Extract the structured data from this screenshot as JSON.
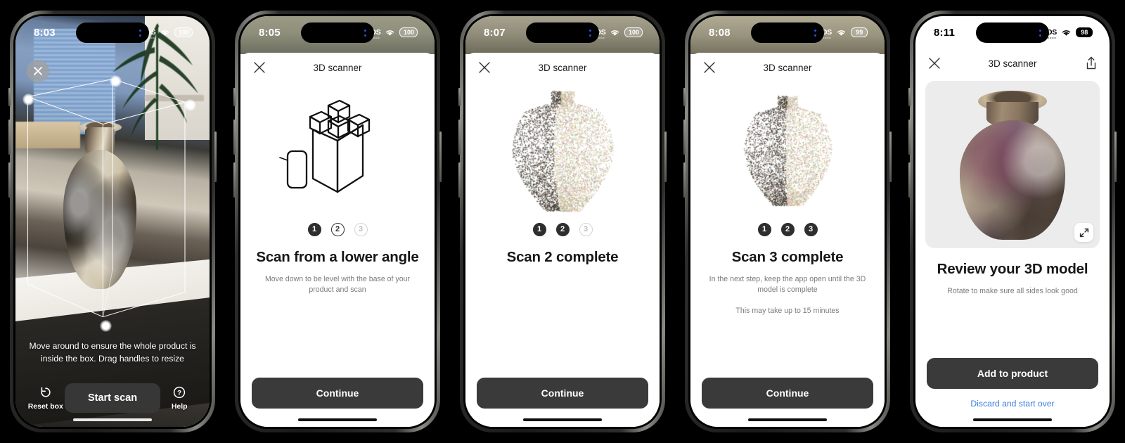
{
  "app": {
    "title": "3D scanner",
    "accent_link": "#3b7ddd",
    "cta_bg": "#3a3a3a"
  },
  "screens": [
    {
      "id": "ar-capture",
      "status": {
        "time": "8:03",
        "sos": "SOS",
        "battery": "100"
      },
      "overlay_text": "Move around to ensure the whole product is inside the box. Drag handles to resize",
      "left_control": {
        "label": "Reset box",
        "icon": "reset-icon"
      },
      "primary_button": "Start scan",
      "right_control": {
        "label": "Help",
        "icon": "help-icon"
      }
    },
    {
      "id": "scan-step-1",
      "status": {
        "time": "8:05",
        "sos": "SOS",
        "battery": "100"
      },
      "nav_title": "3D scanner",
      "steps": [
        {
          "label": "1",
          "state": "filled"
        },
        {
          "label": "2",
          "state": "outline"
        },
        {
          "label": "3",
          "state": "muted"
        }
      ],
      "heading": "Scan from a lower angle",
      "subtext": "Move down to be level with the base of your product and scan",
      "cta": "Continue"
    },
    {
      "id": "scan-2-complete",
      "status": {
        "time": "8:07",
        "sos": "SOS",
        "battery": "100"
      },
      "nav_title": "3D scanner",
      "steps": [
        {
          "label": "1",
          "state": "filled"
        },
        {
          "label": "2",
          "state": "filled"
        },
        {
          "label": "3",
          "state": "muted"
        }
      ],
      "heading": "Scan 2 complete",
      "cta": "Continue"
    },
    {
      "id": "scan-3-complete",
      "status": {
        "time": "8:08",
        "sos": "SOS",
        "battery": "99"
      },
      "nav_title": "3D scanner",
      "steps": [
        {
          "label": "1",
          "state": "filled"
        },
        {
          "label": "2",
          "state": "filled"
        },
        {
          "label": "3",
          "state": "filled"
        }
      ],
      "heading": "Scan 3 complete",
      "subtext": "In the next step, keep the app open until the 3D model is complete",
      "subtext2": "This may take up to 15 minutes",
      "cta": "Continue"
    },
    {
      "id": "review-model",
      "status": {
        "time": "8:11",
        "sos": "SOS",
        "battery": "98"
      },
      "nav_title": "3D scanner",
      "share_icon": "share-icon",
      "expand_icon": "expand-icon",
      "heading": "Review your 3D model",
      "subtext": "Rotate to make sure all sides look good",
      "cta": "Add to product",
      "secondary_link": "Discard and start over"
    }
  ]
}
